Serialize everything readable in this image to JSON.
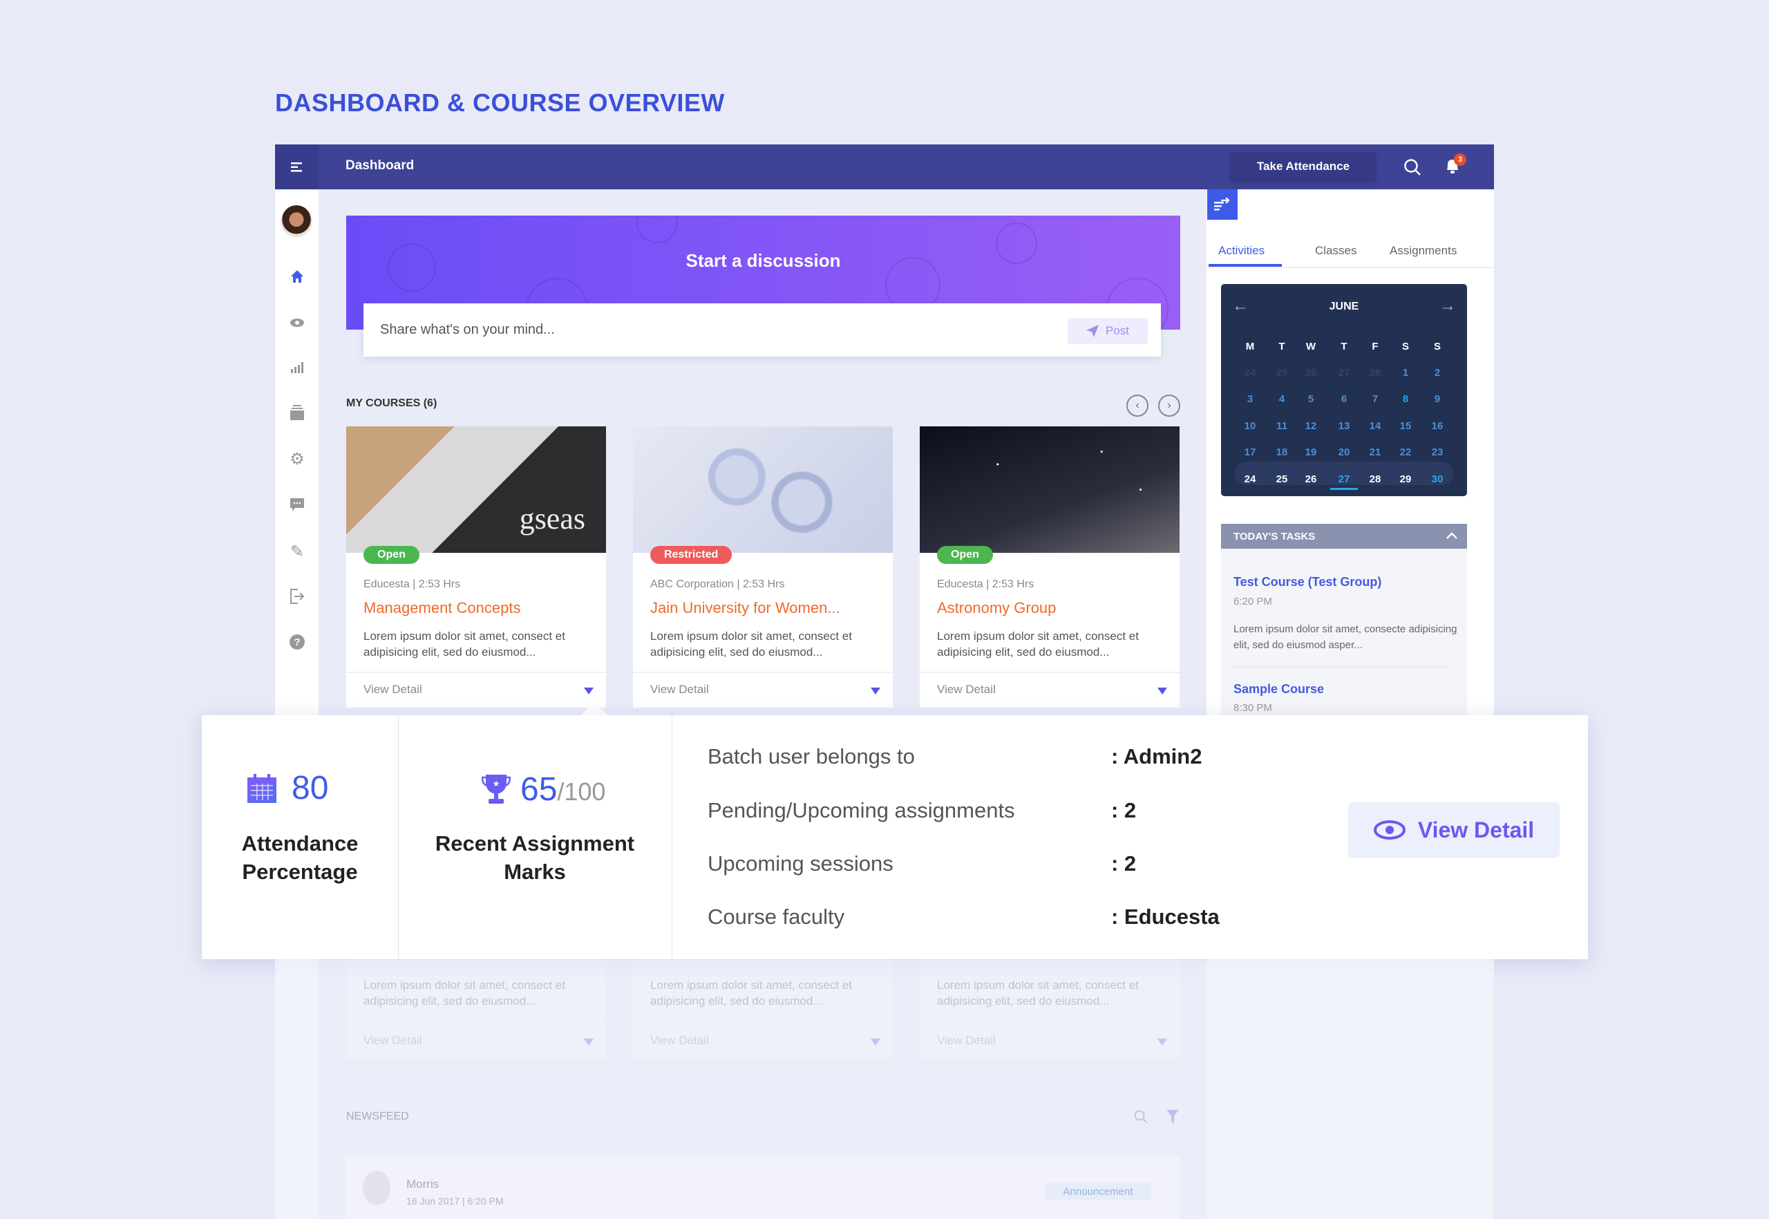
{
  "page_title": "DASHBOARD & COURSE OVERVIEW",
  "header": {
    "title": "Dashboard",
    "take_attendance": "Take Attendance",
    "notification_count": "3"
  },
  "sidebar": {
    "items": [
      "home-icon",
      "eye-icon",
      "bar-chart-icon",
      "archive-icon",
      "gear-icon",
      "chat-icon",
      "pencil-icon",
      "logout-icon",
      "help-icon"
    ],
    "active": "home-icon"
  },
  "discussion": {
    "title": "Start a discussion",
    "placeholder": "Share what's on your mind...",
    "post_label": "Post"
  },
  "courses": {
    "title": "MY COURSES (6)",
    "cards": [
      {
        "badge": "Open",
        "badge_color": "#4cb74f",
        "meta": "Educesta | 2:53 Hrs",
        "title": "Management Concepts",
        "desc": "Lorem ipsum dolor sit amet, consect et adipisicing elit, sed do eiusmod...",
        "view": "View Detail",
        "image_text": "gseas"
      },
      {
        "badge": "Restricted",
        "badge_color": "#ef5a5a",
        "meta": "ABC Corporation | 2:53 Hrs",
        "title": "Jain University for Women...",
        "desc": "Lorem ipsum dolor sit amet, consect et adipisicing elit, sed do eiusmod...",
        "view": "View Detail"
      },
      {
        "badge": "Open",
        "badge_color": "#4cb74f",
        "meta": "Educesta | 2:53 Hrs",
        "title": "Astronomy Group",
        "desc": "Lorem ipsum dolor sit amet, consect et adipisicing elit, sed do eiusmod...",
        "view": "View Detail"
      }
    ],
    "lower_cards": [
      {
        "desc": "Lorem ipsum dolor sit amet, consect et adipisicing elit, sed do eiusmod...",
        "view": "View Detail"
      },
      {
        "desc": "Lorem ipsum dolor sit amet, consect et adipisicing elit, sed do eiusmod...",
        "view": "View Detail"
      },
      {
        "desc": "Lorem ipsum dolor sit amet, consect et adipisicing elit, sed do eiusmod...",
        "view": "View Detail"
      }
    ]
  },
  "newsfeed": {
    "title": "NEWSFEED",
    "post": {
      "author": "Morris",
      "date": "16 Jun 2017 | 6:20 PM",
      "tag": "Announcement"
    }
  },
  "right_panel": {
    "tabs": [
      "Activities",
      "Classes",
      "Assignments"
    ],
    "active_tab": "Activities",
    "calendar": {
      "month": "JUNE",
      "weekdays": [
        "M",
        "T",
        "W",
        "T",
        "F",
        "S",
        "S"
      ],
      "rows": [
        [
          {
            "d": "24",
            "s": "other"
          },
          {
            "d": "25",
            "s": "other"
          },
          {
            "d": "26",
            "s": "other"
          },
          {
            "d": "27",
            "s": "other"
          },
          {
            "d": "28",
            "s": "other"
          },
          {
            "d": "1",
            "s": "normal"
          },
          {
            "d": "2",
            "s": "normal"
          }
        ],
        [
          {
            "d": "3",
            "s": "normal"
          },
          {
            "d": "4",
            "s": "normal"
          },
          {
            "d": "5",
            "s": "normal"
          },
          {
            "d": "6",
            "s": "normal"
          },
          {
            "d": "7",
            "s": "normal"
          },
          {
            "d": "8",
            "s": "accent"
          },
          {
            "d": "9",
            "s": "normal"
          }
        ],
        [
          {
            "d": "10",
            "s": "normal"
          },
          {
            "d": "11",
            "s": "normal"
          },
          {
            "d": "12",
            "s": "normal"
          },
          {
            "d": "13",
            "s": "normal"
          },
          {
            "d": "14",
            "s": "normal"
          },
          {
            "d": "15",
            "s": "normal"
          },
          {
            "d": "16",
            "s": "normal"
          }
        ],
        [
          {
            "d": "17",
            "s": "normal"
          },
          {
            "d": "18",
            "s": "normal"
          },
          {
            "d": "19",
            "s": "normal"
          },
          {
            "d": "20",
            "s": "normal"
          },
          {
            "d": "21",
            "s": "normal"
          },
          {
            "d": "22",
            "s": "normal"
          },
          {
            "d": "23",
            "s": "normal"
          }
        ],
        [
          {
            "d": "24",
            "s": "week"
          },
          {
            "d": "25",
            "s": "week"
          },
          {
            "d": "26",
            "s": "week"
          },
          {
            "d": "27",
            "s": "today"
          },
          {
            "d": "28",
            "s": "week"
          },
          {
            "d": "29",
            "s": "week"
          },
          {
            "d": "30",
            "s": "accent"
          }
        ]
      ]
    },
    "tasks": {
      "title": "TODAY'S TASKS",
      "items": [
        {
          "title": "Test Course (Test Group)",
          "time": "6:20 PM",
          "desc": "Lorem ipsum dolor sit amet, consecte adipisicing elit, sed do eiusmod asper..."
        },
        {
          "title": "Sample Course",
          "time": "8:30 PM"
        }
      ]
    }
  },
  "overlay": {
    "attendance": {
      "value": "80",
      "label": "Attendance Percentage"
    },
    "marks": {
      "value": "65",
      "total": "/100",
      "label": "Recent Assignment Marks"
    },
    "rows": [
      {
        "label": "Batch user belongs to",
        "value": ": Admin2"
      },
      {
        "label": "Pending/Upcoming assignments",
        "value": ": 2"
      },
      {
        "label": "Upcoming sessions",
        "value": ": 2"
      },
      {
        "label": "Course faculty",
        "value": ": Educesta"
      }
    ],
    "view_detail": "View Detail"
  }
}
